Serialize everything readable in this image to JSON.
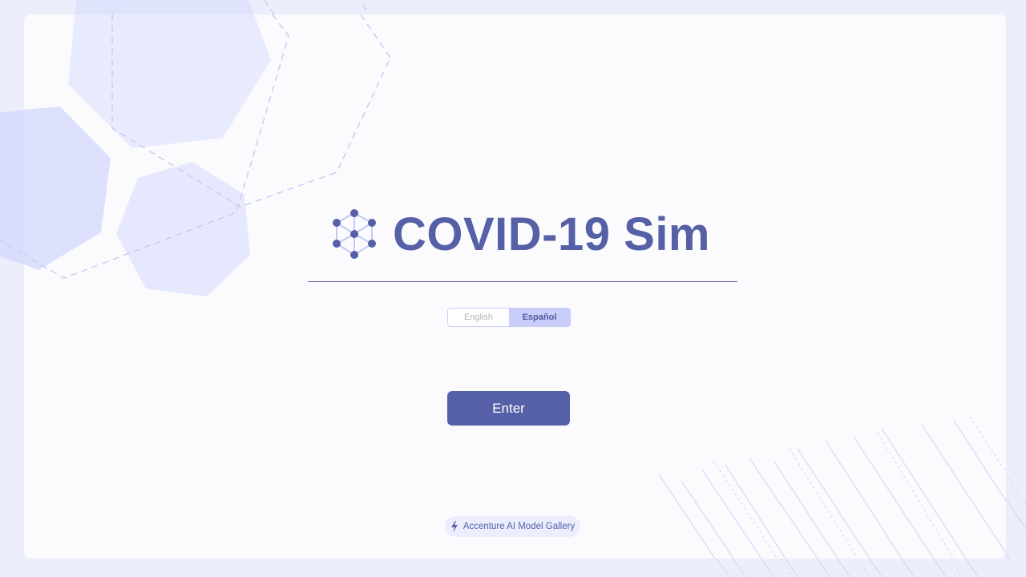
{
  "app": {
    "title": "COVID-19 Sim",
    "logo_icon": "molecule-cube-icon"
  },
  "language": {
    "options": [
      "English",
      "Español"
    ],
    "selected": "Español"
  },
  "actions": {
    "enter_label": "Enter"
  },
  "footer": {
    "badge_label": "Accenture AI Model Gallery",
    "badge_icon": "lightning-bolt-icon"
  },
  "colors": {
    "primary": "#5560a6",
    "accent_light": "#c9cdfa",
    "background": "#eceefc"
  }
}
